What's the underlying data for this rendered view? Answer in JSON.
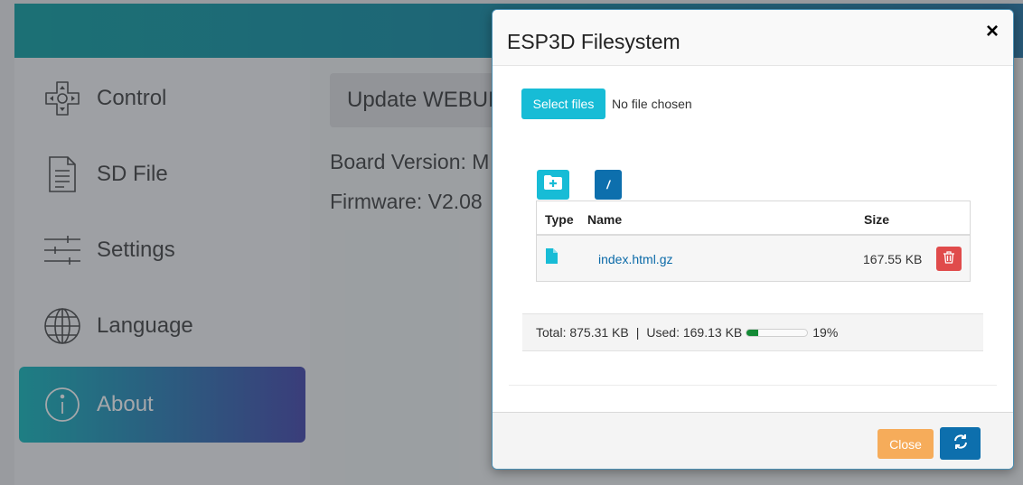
{
  "app": {
    "sidebar": {
      "items": [
        {
          "label": "Control",
          "icon": "control-pad-icon"
        },
        {
          "label": "SD File",
          "icon": "document-icon"
        },
        {
          "label": "Settings",
          "icon": "sliders-icon"
        },
        {
          "label": "Language",
          "icon": "globe-icon"
        },
        {
          "label": "About",
          "icon": "info-icon",
          "active": true
        }
      ]
    },
    "main": {
      "update_button": "Update WEBUI",
      "board_version": "Board Version: M",
      "firmware": "Firmware: V2.08"
    }
  },
  "modal": {
    "title": "ESP3D Filesystem",
    "close_glyph": "×",
    "select_files_label": "Select files",
    "no_file_text": "No file chosen",
    "path_label": "/",
    "table": {
      "headers": {
        "type": "Type",
        "name": "Name",
        "size": "Size"
      },
      "rows": [
        {
          "type_icon": "file-icon",
          "name": "index.html.gz",
          "size": "167.55 KB"
        }
      ]
    },
    "status": {
      "total": "Total: 875.31 KB",
      "separator": "|",
      "used": "Used: 169.13 KB",
      "percent_label": "19%",
      "percent_value": 19
    },
    "footer": {
      "close_label": "Close"
    }
  },
  "colors": {
    "accent_cyan": "#17bcd6",
    "accent_blue": "#0d6fad",
    "danger_red": "#e04b4b",
    "warning_orange": "#f6ac5a",
    "progress_green": "#138a35"
  }
}
